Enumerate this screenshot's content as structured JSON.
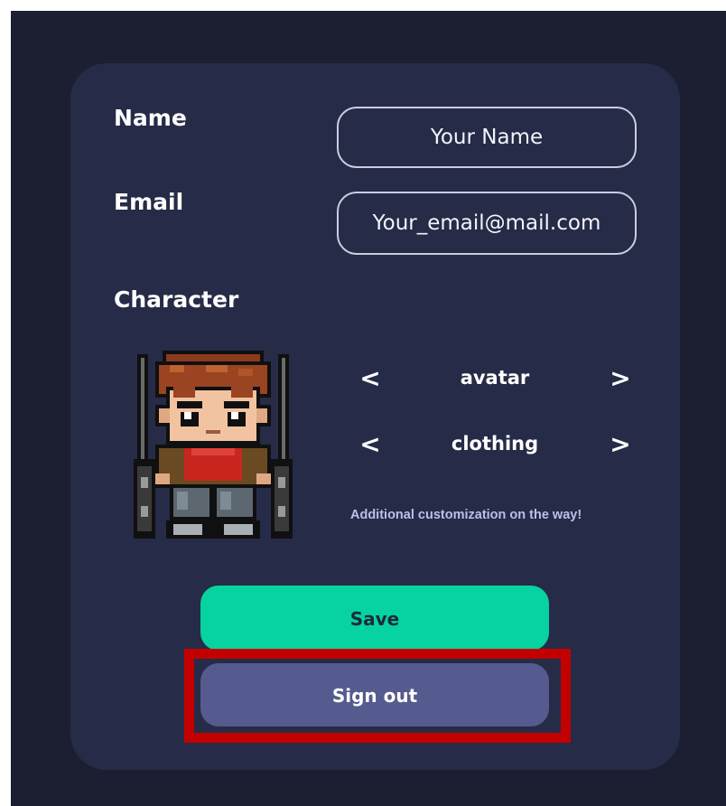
{
  "form": {
    "name_label": "Name",
    "name_placeholder": "Your Name",
    "email_label": "Email",
    "email_placeholder": "Your_email@mail.com",
    "character_label": "Character"
  },
  "character": {
    "prev_glyph": "<",
    "next_glyph": ">",
    "options": [
      "avatar",
      "clothing"
    ],
    "note": "Additional customization on the way!"
  },
  "buttons": {
    "save": "Save",
    "sign_out": "Sign out"
  },
  "colors": {
    "background": "#1b1f31",
    "card": "#262b47",
    "save_button": "#06d3a0",
    "signout_button": "#555b8e",
    "highlight": "#c30000"
  },
  "icons": [
    "chevron-left-icon",
    "chevron-right-icon"
  ]
}
